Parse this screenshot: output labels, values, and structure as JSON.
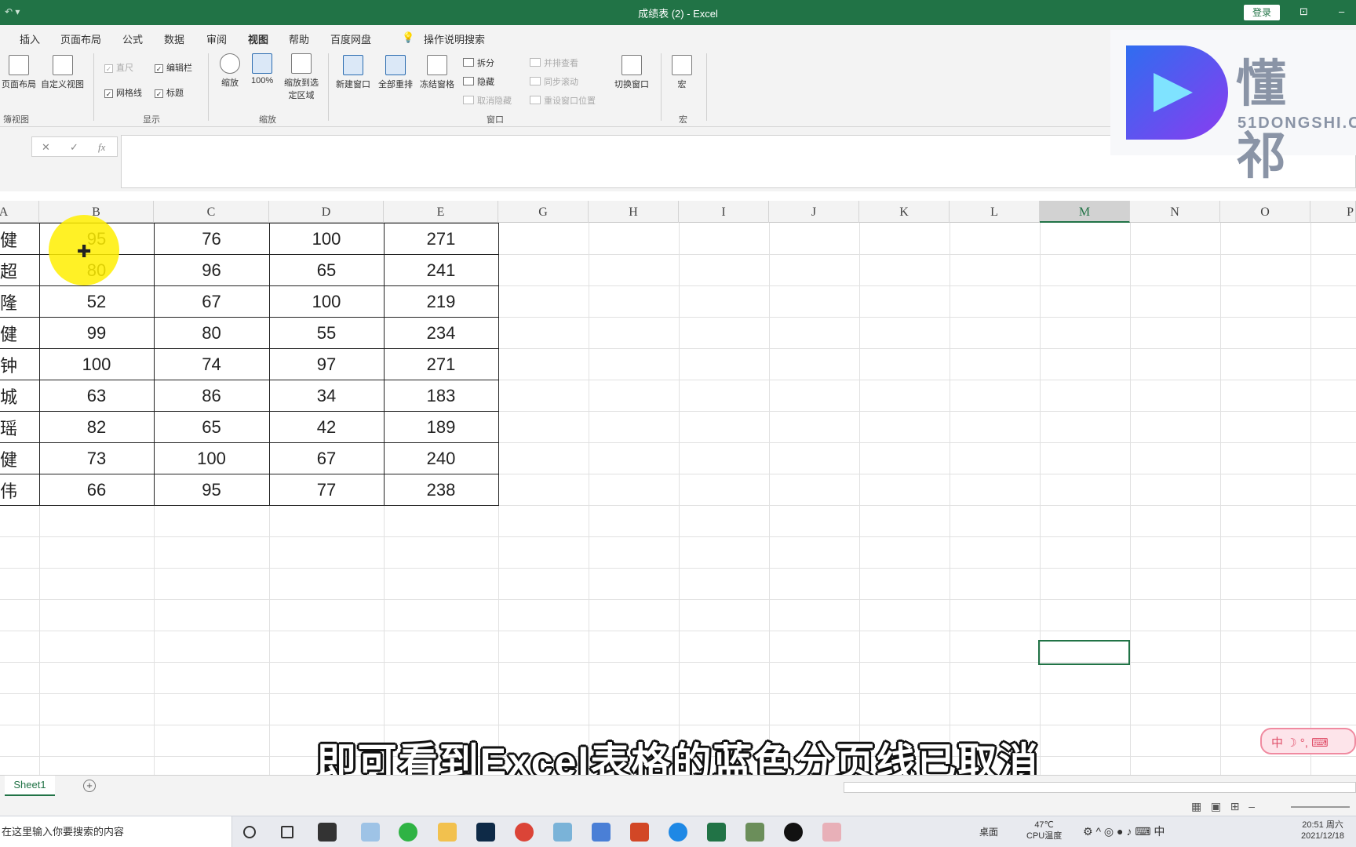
{
  "window": {
    "title": "成绩表 (2)  -  Excel",
    "login": "登录"
  },
  "tabs": [
    "插入",
    "页面布局",
    "公式",
    "数据",
    "审阅",
    "视图",
    "帮助",
    "百度网盘",
    "操作说明搜索"
  ],
  "active_tab": "视图",
  "ribbon": {
    "workbook_views": {
      "items": [
        "页面布局",
        "自定义视图"
      ],
      "group": "簿视图"
    },
    "show": {
      "ruler": "直尺",
      "formula_bar": "编辑栏",
      "gridlines": "网格线",
      "headings": "标题",
      "group": "显示"
    },
    "zoom": {
      "zoom": "缩放",
      "hundred": "100%",
      "to_selection": "缩放到选定区域",
      "group": "缩放"
    },
    "window": {
      "new_window": "新建窗口",
      "arrange_all": "全部重排",
      "freeze": "冻结窗格",
      "split": "拆分",
      "hide": "隐藏",
      "unhide": "取消隐藏",
      "side_by_side": "并排查看",
      "sync_scroll": "同步滚动",
      "reset_pos": "重设窗口位置",
      "switch": "切换窗口",
      "group": "窗口"
    },
    "macros": {
      "macro": "宏",
      "group": "宏"
    }
  },
  "formula_bar": {
    "cancel": "✕",
    "enter": "✓",
    "fx": "fx"
  },
  "logo": {
    "brand": "懂 祁",
    "site": "51DONGSHI.C"
  },
  "columns": [
    "A",
    "B",
    "C",
    "D",
    "E",
    "G",
    "H",
    "I",
    "J",
    "K",
    "L",
    "M",
    "N",
    "O",
    "P"
  ],
  "selected_column": "M",
  "table": {
    "rows": [
      {
        "name": "健",
        "values": [
          "95",
          "76",
          "100",
          "271"
        ]
      },
      {
        "name": "超",
        "values": [
          "80",
          "96",
          "65",
          "241"
        ]
      },
      {
        "name": "隆",
        "values": [
          "52",
          "67",
          "100",
          "219"
        ]
      },
      {
        "name": "健",
        "values": [
          "99",
          "80",
          "55",
          "234"
        ]
      },
      {
        "name": "钟",
        "values": [
          "100",
          "74",
          "97",
          "271"
        ]
      },
      {
        "name": "城",
        "values": [
          "63",
          "86",
          "34",
          "183"
        ]
      },
      {
        "name": "瑶",
        "values": [
          "82",
          "65",
          "42",
          "189"
        ]
      },
      {
        "name": "健",
        "values": [
          "73",
          "100",
          "67",
          "240"
        ]
      },
      {
        "name": "伟",
        "values": [
          "66",
          "95",
          "77",
          "238"
        ]
      }
    ]
  },
  "sheet_tab": "Sheet1",
  "subtitle": "即可看到Excel表格的蓝色分页线已取消",
  "ime": "中 ☽ °, ⌨",
  "taskbar": {
    "search": "在这里输入你要搜索的内容",
    "desktop": "桌面",
    "temp": "47℃",
    "temp_label": "CPU温度",
    "time": "20:51 周六",
    "date": "2021/12/18"
  },
  "colors": {
    "excel_green": "#217346",
    "highlight": "#ffee00"
  }
}
